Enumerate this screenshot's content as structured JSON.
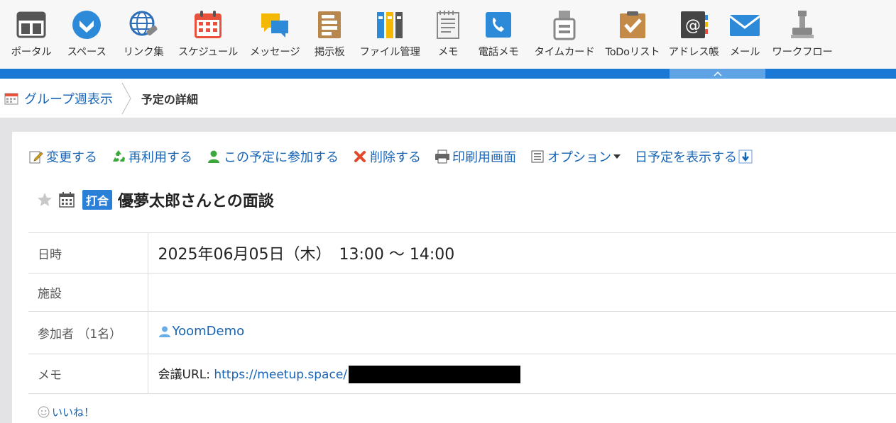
{
  "app_menu": [
    {
      "label": "ポータル",
      "icon": "portal-icon"
    },
    {
      "label": "スペース",
      "icon": "space-icon"
    },
    {
      "label": "リンク集",
      "icon": "link-globe-icon"
    },
    {
      "label": "スケジュール",
      "icon": "schedule-calendar-icon"
    },
    {
      "label": "メッセージ",
      "icon": "message-bubble-icon"
    },
    {
      "label": "掲示板",
      "icon": "bulletin-board-icon"
    },
    {
      "label": "ファイル管理",
      "icon": "file-binders-icon"
    },
    {
      "label": "メモ",
      "icon": "memo-notepad-icon"
    },
    {
      "label": "電話メモ",
      "icon": "phone-memo-icon"
    },
    {
      "label": "タイムカード",
      "icon": "timecard-icon"
    },
    {
      "label": "ToDoリスト",
      "icon": "todo-check-icon"
    },
    {
      "label": "アドレス帳",
      "icon": "address-book-icon"
    },
    {
      "label": "メール",
      "icon": "mail-envelope-icon"
    },
    {
      "label": "ワークフロー",
      "icon": "workflow-stamp-icon"
    }
  ],
  "breadcrumb": {
    "parent": "グループ週表示",
    "current": "予定の詳細"
  },
  "toolbar": {
    "edit": "変更する",
    "reuse": "再利用する",
    "join": "この予定に参加する",
    "delete": "削除する",
    "print": "印刷用画面",
    "options": "オプション",
    "show_day": "日予定を表示する"
  },
  "event": {
    "badge": "打合",
    "title": "優夢太郎さんとの面談"
  },
  "details": {
    "datetime_label": "日時",
    "datetime_value": "2025年06月05日（木）　13:00 ～ 14:00",
    "facility_label": "施設",
    "facility_value": "",
    "attendees_label": "参加者 （1名）",
    "attendee_name": "YoomDemo",
    "memo_label": "メモ",
    "memo_prefix": "会議URL: ",
    "memo_url": "https://meetup.space/"
  },
  "like": "いいね！",
  "colors": {
    "accent_blue": "#1b79d6",
    "link": "#1864b5",
    "badge": "#2a7fd6"
  }
}
